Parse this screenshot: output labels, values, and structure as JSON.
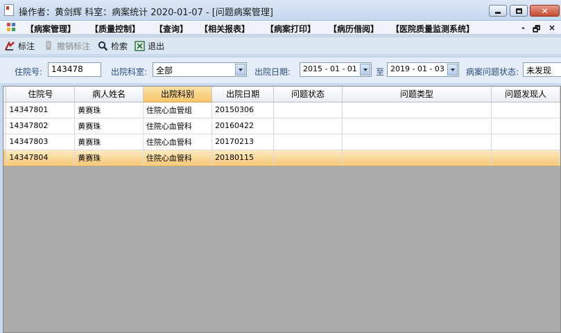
{
  "window": {
    "title": "操作者：黄剑辉  科室：病案统计  2020-01-07 - [问题病案管理]",
    "controls": {
      "minimize": "—",
      "maximize": "□",
      "close": "✕"
    }
  },
  "menu": {
    "items": [
      {
        "label": "【病案管理】"
      },
      {
        "label": "【质量控制】"
      },
      {
        "label": "【查询】"
      },
      {
        "label": "【相关报表】"
      },
      {
        "label": "【病案打印】"
      },
      {
        "label": "【病历借阅】"
      },
      {
        "label": "【医院质量监测系统】"
      }
    ],
    "mdi": {
      "minimize": "-",
      "restore": "🗗",
      "close": "×"
    }
  },
  "toolbar": {
    "mark": "标注",
    "unmark": "撤销标注",
    "search": "检索",
    "exit": "退出"
  },
  "filters": {
    "admission_no_label": "住院号:",
    "admission_no_value": "143478",
    "dept_label": "出院科室:",
    "dept_value": "全部",
    "date_label": "出院日期:",
    "date_from": "2015 - 01 - 01",
    "date_to_sep": "至",
    "date_to": "2019 - 01 - 03",
    "status_label": "病案问题状态:",
    "status_value": "未发现"
  },
  "grid": {
    "columns": [
      "住院号",
      "病人姓名",
      "出院科别",
      "出院日期",
      "问题状态",
      "问题类型",
      "问题发现人"
    ],
    "rows": [
      [
        "14347801",
        "黄赛珠",
        "住院心血管组",
        "20150306",
        "",
        "",
        ""
      ],
      [
        "14347802",
        "黄赛珠",
        "住院心血管科",
        "20160422",
        "",
        "",
        ""
      ],
      [
        "14347803",
        "黄赛珠",
        "住院心血管科",
        "20170213",
        "",
        "",
        ""
      ],
      [
        "14347804",
        "黄赛珠",
        "住院心血管科",
        "20180115",
        "",
        "",
        ""
      ]
    ]
  },
  "colors": {
    "selected_row": "#f7c879",
    "sorted_header": "#f6c56b",
    "empty_grid": "#ababab"
  }
}
